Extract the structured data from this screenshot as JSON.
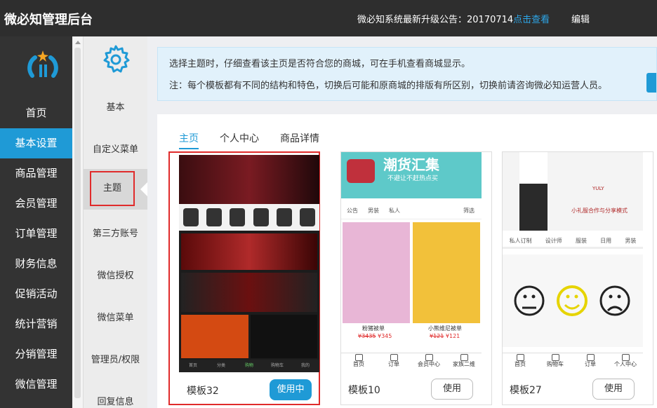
{
  "header": {
    "title": "微必知管理后台",
    "notice_text": "微必知系统最新升级公告：20170714",
    "notice_link": "点击查看",
    "edit_label": "编辑"
  },
  "leftnav": {
    "items": [
      {
        "label": "首页"
      },
      {
        "label": "基本设置"
      },
      {
        "label": "商品管理"
      },
      {
        "label": "会员管理"
      },
      {
        "label": "订单管理"
      },
      {
        "label": "财务信息"
      },
      {
        "label": "促销活动"
      },
      {
        "label": "统计营销"
      },
      {
        "label": "分销管理"
      },
      {
        "label": "微信管理"
      }
    ]
  },
  "subnav": {
    "heading": "基本",
    "items": [
      {
        "label": "自定义菜单"
      },
      {
        "label": "主题"
      },
      {
        "label": "第三方账号"
      },
      {
        "label": "微信授权"
      },
      {
        "label": "微信菜单"
      },
      {
        "label": "管理员/权限"
      },
      {
        "label": "回复信息"
      }
    ]
  },
  "info": {
    "line1": "选择主题时，仔细查看该主页是否符合您的商城，可在手机查看商城显示。",
    "line2": "注：每个模板都有不同的结构和特色，切换后可能和原商城的排版有所区别，切换前请咨询微必知运营人员。"
  },
  "tabs": [
    {
      "label": "主页"
    },
    {
      "label": "个人中心"
    },
    {
      "label": "商品详情"
    }
  ],
  "templates": [
    {
      "name": "模板32",
      "button": "使用中",
      "tabbar": [
        "首页",
        "分类",
        "购物",
        "购物车",
        "我的"
      ]
    },
    {
      "name": "模板10",
      "button": "使用",
      "banner_title": "潮货汇集",
      "banner_sub": "不避让不赶热点买",
      "filter": [
        "公告",
        "男装",
        "私人",
        "筛选"
      ],
      "products": [
        {
          "name": "粉猪被单",
          "old": "¥3435",
          "price": "¥345"
        },
        {
          "name": "小熊维尼被单",
          "old": "¥121",
          "price": "¥121"
        }
      ],
      "tabbar": [
        "首页",
        "订单",
        "会员中心",
        "家族二维"
      ]
    },
    {
      "name": "模板27",
      "button": "使用",
      "brand": "YULY",
      "brand_sub": "小礼服合作与分享模式",
      "menu": [
        "私人订制",
        "设计师",
        "服装",
        "日用",
        "男装"
      ],
      "tabbar": [
        "首页",
        "购物车",
        "订单",
        "个人中心"
      ]
    }
  ],
  "colors": {
    "accent": "#1f9ad6",
    "topbar": "#2e2e2e",
    "leftnav": "#333333",
    "highlight_border": "#e02b2b"
  }
}
